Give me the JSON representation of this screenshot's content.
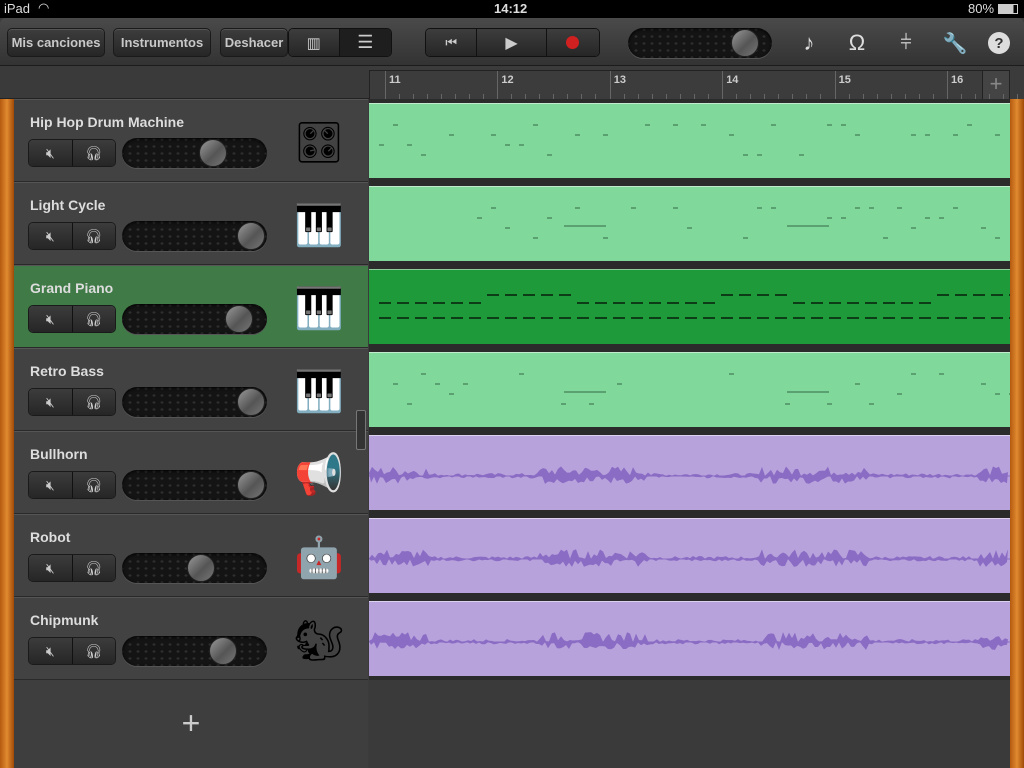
{
  "status": {
    "device": "iPad",
    "time": "14:12",
    "battery": "80%"
  },
  "toolbar": {
    "my_songs": "Mis canciones",
    "instruments": "Instrumentos",
    "undo": "Deshacer",
    "master_volume": 0.9,
    "record_color": "#d02020"
  },
  "ruler": {
    "bars": [
      "11",
      "12",
      "13",
      "14",
      "15",
      "16"
    ],
    "add_label": "+"
  },
  "tracks": [
    {
      "name": "Hip Hop Drum Machine",
      "volume": 0.66,
      "icon": "drum-machine-icon",
      "glyph": "🎛",
      "type": "midi",
      "selected": false
    },
    {
      "name": "Light Cycle",
      "volume": 1.0,
      "icon": "keyboard-synth-icon",
      "glyph": "🎹",
      "type": "midi",
      "selected": false
    },
    {
      "name": "Grand Piano",
      "volume": 0.89,
      "icon": "grand-piano-icon",
      "glyph": "🎹",
      "type": "midi",
      "selected": true
    },
    {
      "name": "Retro Bass",
      "volume": 1.0,
      "icon": "keyboard-synth-icon",
      "glyph": "🎹",
      "type": "midi",
      "selected": false
    },
    {
      "name": "Bullhorn",
      "volume": 1.0,
      "icon": "bullhorn-icon",
      "glyph": "📢",
      "type": "audio",
      "selected": false
    },
    {
      "name": "Robot",
      "volume": 0.56,
      "icon": "robot-icon",
      "glyph": "🤖",
      "type": "audio",
      "selected": false
    },
    {
      "name": "Chipmunk",
      "volume": 0.75,
      "icon": "chipmunk-icon",
      "glyph": "🐿",
      "type": "audio",
      "selected": false
    }
  ],
  "add_track_label": "+",
  "colors": {
    "midi": "#80d99b",
    "midi_selected": "#1f9a3a",
    "audio": "#b8a2dc",
    "note": "#5aa070",
    "wave": "#8a6cc4"
  }
}
